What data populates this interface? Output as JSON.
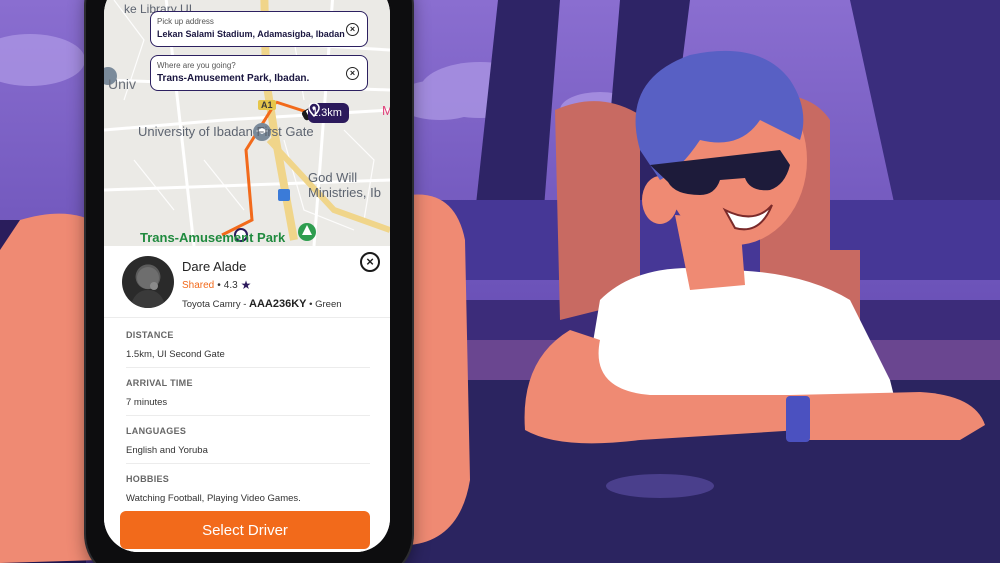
{
  "map": {
    "top_label": "ke Library UI",
    "side_label": "Univ",
    "university_label": "University of Ibadan First Gate",
    "godwill_label": "God Will Ministries, Ib",
    "destination_label": "Trans-Amusement Park",
    "road_tag": "A1",
    "edge_label": "M",
    "distance": "1.3km"
  },
  "pickup": {
    "label": "Pick up address",
    "value": "Lekan Salami Stadium, Adamasigba, Ibadan"
  },
  "destination": {
    "label": "Where are you going?",
    "value": "Trans-Amusement Park, Ibadan."
  },
  "driver": {
    "name": "Dare Alade",
    "ride_type": "Shared",
    "separator": "•",
    "rating": "4.3",
    "car": "Toyota Camry -",
    "plate": "AAA236KY",
    "color": "• Green"
  },
  "details": [
    {
      "key": "DISTANCE",
      "value": "1.5km, UI Second Gate"
    },
    {
      "key": "ARRIVAL TIME",
      "value": "7 minutes"
    },
    {
      "key": "LANGUAGES",
      "value": "English and Yoruba"
    },
    {
      "key": "HOBBIES",
      "value": "Watching Football, Playing Video Games."
    }
  ],
  "action": {
    "select_label": "Select Driver"
  },
  "colors": {
    "accent": "#f26a1b",
    "brand": "#2c1a5c",
    "route": "#f26a1b",
    "park_green": "#1f8a3e"
  }
}
